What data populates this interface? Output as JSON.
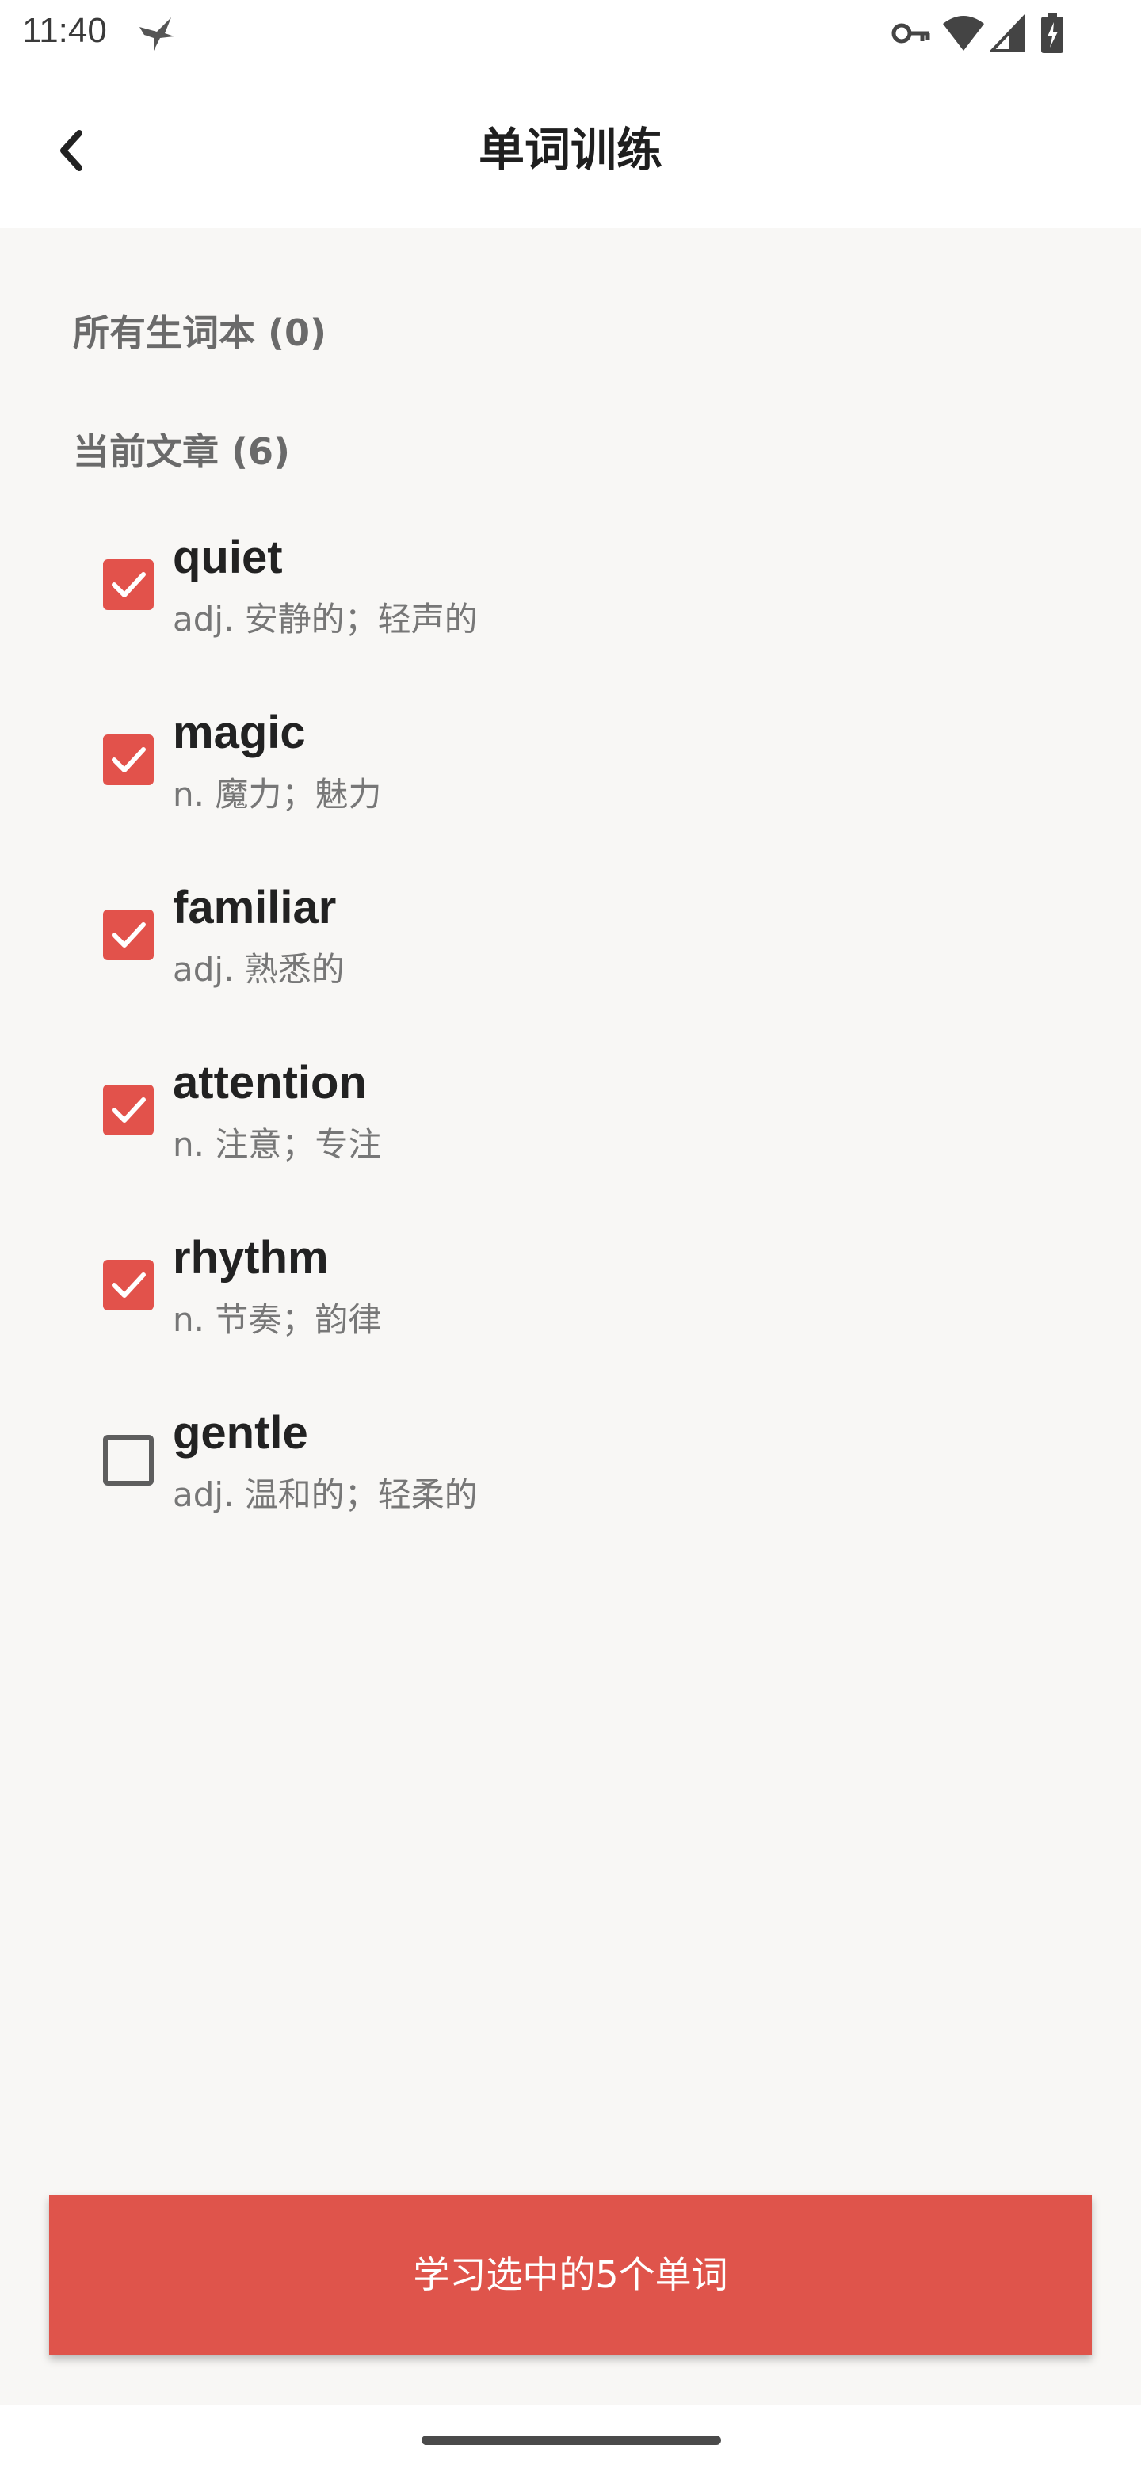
{
  "status_bar": {
    "time": "11:40",
    "icons": [
      "bird-icon",
      "key-icon",
      "wifi-icon",
      "signal-icon",
      "battery-charging-icon"
    ]
  },
  "app_bar": {
    "title": "单词训练",
    "back_icon": "chevron-left-icon"
  },
  "sections": {
    "all_vocab_label": "所有生词本 (0)",
    "current_article_label": "当前文章 (6)"
  },
  "words": [
    {
      "word": "quiet",
      "definition": "adj. 安静的；轻声的",
      "checked": true
    },
    {
      "word": "magic",
      "definition": "n. 魔力；魅力",
      "checked": true
    },
    {
      "word": "familiar",
      "definition": "adj. 熟悉的",
      "checked": true
    },
    {
      "word": "attention",
      "definition": "n. 注意；专注",
      "checked": true
    },
    {
      "word": "rhythm",
      "definition": "n. 节奏；韵律",
      "checked": true
    },
    {
      "word": "gentle",
      "definition": "adj. 温和的；轻柔的",
      "checked": false
    }
  ],
  "action": {
    "study_label": "学习选中的5个单词"
  },
  "colors": {
    "accent": "#e2524b",
    "background": "#f8f7f5"
  }
}
